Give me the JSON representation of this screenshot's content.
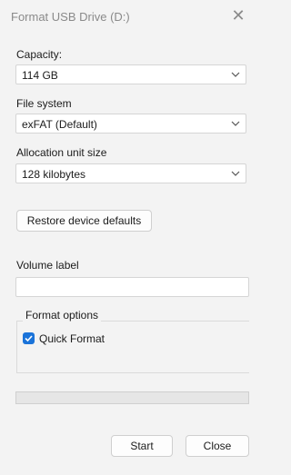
{
  "window": {
    "title": "Format USB Drive (D:)"
  },
  "capacity": {
    "label": "Capacity:",
    "value": "114 GB"
  },
  "file_system": {
    "label": "File system",
    "value": "exFAT (Default)"
  },
  "allocation": {
    "label": "Allocation unit size",
    "value": "128 kilobytes"
  },
  "buttons": {
    "restore_defaults": "Restore device defaults",
    "start": "Start",
    "close": "Close"
  },
  "volume": {
    "label": "Volume label",
    "value": ""
  },
  "format_options": {
    "title": "Format options",
    "quick_format_label": "Quick Format",
    "quick_format_checked": true
  },
  "progress": {
    "value": 0
  },
  "icons": {
    "close": "close-icon",
    "chevron": "chevron-down-icon",
    "check": "check-icon"
  },
  "colors": {
    "accent": "#1a73d9",
    "window_bg": "#f3f3f3"
  }
}
